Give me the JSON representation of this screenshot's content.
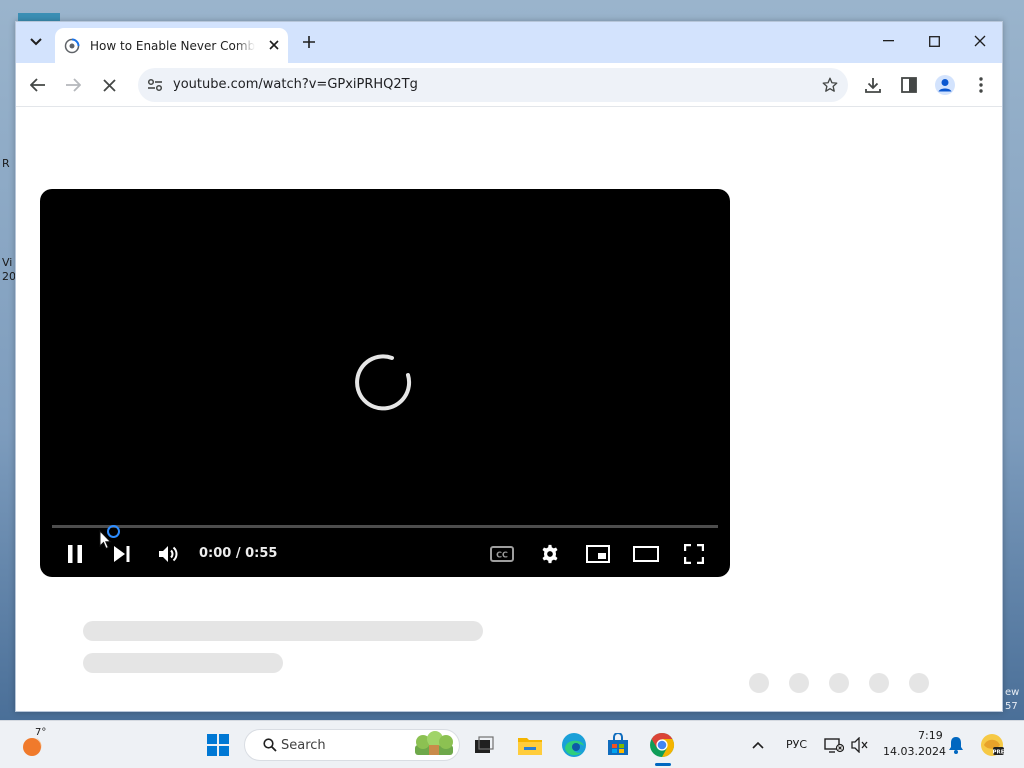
{
  "desktop": {
    "left_glyphs": [
      "R",
      "Vi",
      "20"
    ],
    "right_glyphs": [
      "ew",
      "57"
    ]
  },
  "browser": {
    "tab": {
      "title": "How to Enable Never Combine",
      "favicon": "loading-globe-icon"
    },
    "new_tab_label": "+",
    "window_controls": [
      "minimize-icon",
      "maximize-icon",
      "close-icon"
    ],
    "toolbar": {
      "back_icon": "back-arrow-icon",
      "forward_icon": "forward-arrow-icon",
      "stop_icon": "stop-loading-icon",
      "url": "youtube.com/watch?v=GPxiPRHQ2Tg",
      "bookmark_icon": "star-icon",
      "extras": [
        "download-icon",
        "side-panel-icon",
        "profile-icon",
        "kebab-menu-icon"
      ]
    }
  },
  "player": {
    "state": "loading",
    "progress": 0.0,
    "time": "0:00 / 0:55",
    "controls": [
      "pause-icon",
      "next-icon",
      "volume-icon",
      "captions-icon",
      "settings-icon",
      "miniplayer-icon",
      "theater-icon",
      "fullscreen-icon"
    ]
  },
  "taskbar": {
    "weather_temp": "7°",
    "search_placeholder": "Search",
    "apps": [
      "start-icon",
      "search-icon",
      "task-view-icon",
      "file-explorer-icon",
      "edge-icon",
      "store-icon",
      "chrome-icon"
    ],
    "active_app": "chrome-icon",
    "language": "РУС",
    "time": "7:19",
    "date": "14.03.2024",
    "colors": {
      "accent": "#0067c0",
      "chrome_red": "#db4437",
      "chrome_yellow": "#f4b400",
      "chrome_green": "#0f9d58",
      "chrome_blue": "#4285f4"
    }
  }
}
